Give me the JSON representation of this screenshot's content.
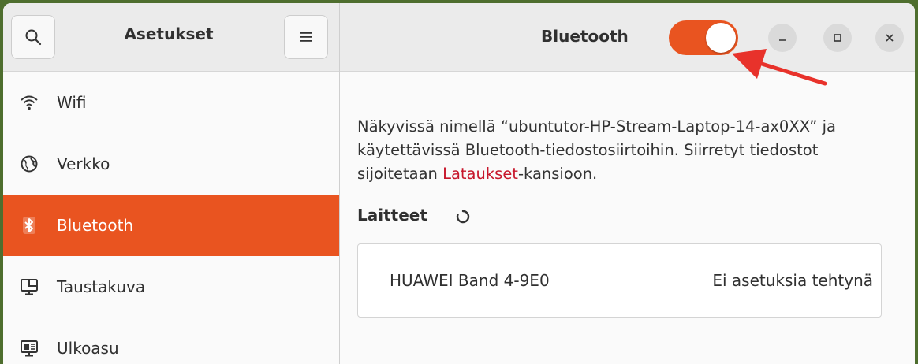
{
  "app": {
    "title": "Asetukset"
  },
  "header": {
    "page_title": "Bluetooth",
    "bluetooth_enabled": true
  },
  "sidebar": {
    "items": [
      {
        "label": "Wifi",
        "icon": "wifi-icon"
      },
      {
        "label": "Verkko",
        "icon": "network-globe-icon"
      },
      {
        "label": "Bluetooth",
        "icon": "bluetooth-icon",
        "active": true
      },
      {
        "label": "Taustakuva",
        "icon": "background-monitor-icon"
      },
      {
        "label": "Ulkoasu",
        "icon": "appearance-icon"
      }
    ]
  },
  "main": {
    "desc_part1": "Näkyvissä nimellä “ubuntutor-HP-Stream-Laptop-14-ax0XX” ja käytettävissä Bluetooth-tiedostosiirtoihin. Siirretyt tiedostot sijoitetaan ",
    "desc_link": "Lataukset",
    "desc_part2": "-kansioon.",
    "devices_label": "Laitteet",
    "devices": [
      {
        "name": "HUAWEI Band 4-9E0",
        "status": "Ei asetuksia tehtynä"
      }
    ]
  },
  "colors": {
    "accent": "#e95420",
    "link": "#c7162b",
    "annotation_arrow": "#e8322b"
  }
}
